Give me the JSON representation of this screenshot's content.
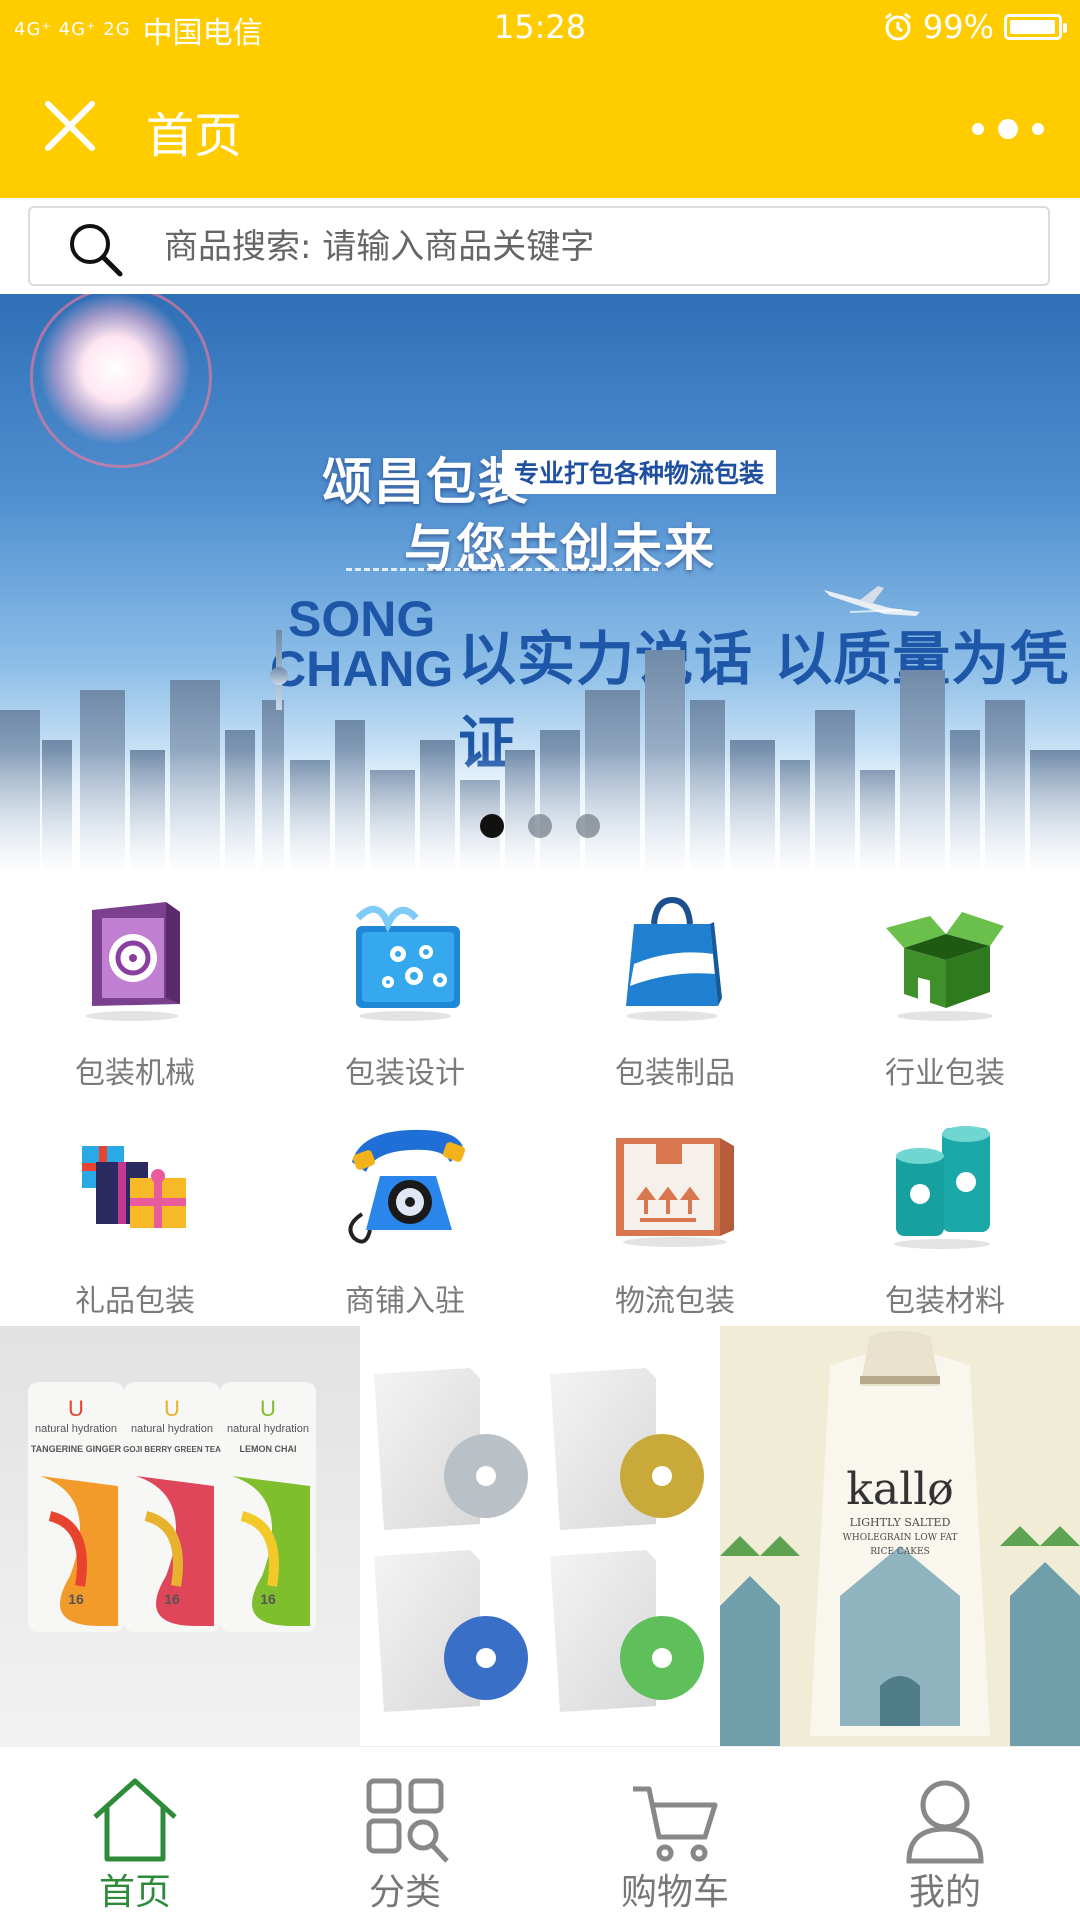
{
  "status_bar": {
    "network": "4G⁺ 4G⁺ 2G",
    "carrier": "中国电信",
    "time": "15:28",
    "alarm_icon": "alarm-clock-icon",
    "battery": "99%",
    "battery_level": 0.99
  },
  "header": {
    "title": "首页",
    "close_icon": "close-icon",
    "more_icon": "more-dots-icon",
    "background": "#ffcc00"
  },
  "search": {
    "placeholder": "商品搜索: 请输入商品关键字",
    "icon": "search-icon"
  },
  "banner": {
    "title": "颂昌包装",
    "tag": "专业打包各种物流包装",
    "subtitle": "与您共创未来",
    "brand_line1": "SONG",
    "brand_line2": "CHANG",
    "slogan": "以实力说话 以质量为凭证",
    "dots_total": 3,
    "active_dot": 1
  },
  "categories": [
    {
      "label": "包装机械",
      "icon": "packaging-machine-icon"
    },
    {
      "label": "包装设计",
      "icon": "gift-design-icon"
    },
    {
      "label": "包装制品",
      "icon": "shopping-bag-icon"
    },
    {
      "label": "行业包装",
      "icon": "open-box-icon"
    },
    {
      "label": "礼品包装",
      "icon": "gift-boxes-icon"
    },
    {
      "label": "商铺入驻",
      "icon": "telephone-icon"
    },
    {
      "label": "物流包装",
      "icon": "shipping-carton-icon"
    },
    {
      "label": "包装材料",
      "icon": "material-rolls-icon"
    }
  ],
  "products": [
    {
      "name": "natural-hydration-cans",
      "brand": "natural hydration",
      "flavors": [
        "TANGERINE GINGER",
        "GOJI BERRY GREEN TEA",
        "LEMON CHAI"
      ],
      "count": "16"
    },
    {
      "name": "software-disc-boxes"
    },
    {
      "name": "kallo-rice-cakes-bag",
      "brand": "kallø",
      "text1": "LIGHTLY SALTED",
      "text2": "WHOLEGRAIN LOW FAT",
      "text3": "RICE CAKES"
    }
  ],
  "tabs": [
    {
      "label": "首页",
      "icon": "home-icon",
      "active": true
    },
    {
      "label": "分类",
      "icon": "category-grid-icon",
      "active": false
    },
    {
      "label": "购物车",
      "icon": "cart-icon",
      "active": false
    },
    {
      "label": "我的",
      "icon": "user-icon",
      "active": false
    }
  ],
  "colors": {
    "accent": "#ffcc00",
    "active_tab": "#2e8b3a",
    "label_gray": "#7a7a7a"
  }
}
